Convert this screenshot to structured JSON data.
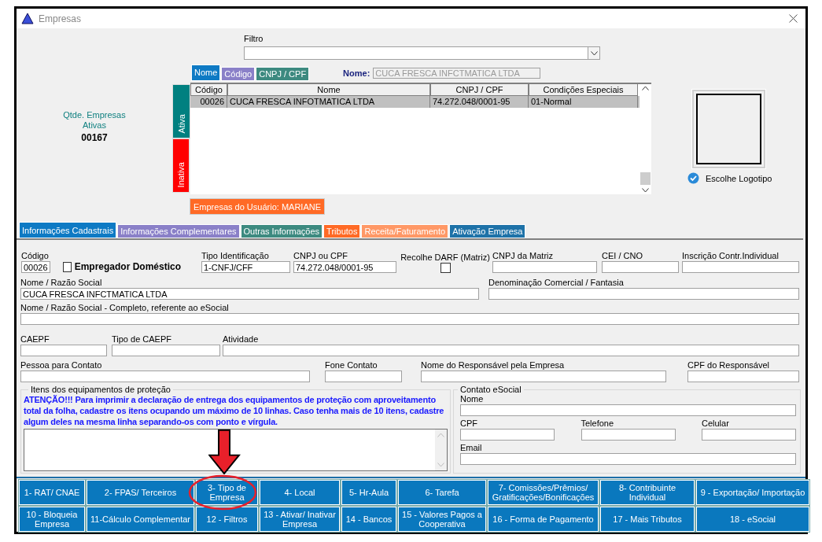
{
  "window": {
    "title": "Empresas"
  },
  "summary": {
    "label": "Qtde. Empresas",
    "sublabel": "Ativas",
    "count": "00167"
  },
  "filter": {
    "label": "Filtro"
  },
  "search": {
    "tabs": [
      {
        "label": "Nome",
        "selected": true,
        "color": "#0e7ac4"
      },
      {
        "label": "Código",
        "selected": false,
        "color": "#8a80c8"
      },
      {
        "label": "CNPJ / CPF",
        "selected": false,
        "color": "#3d8a80"
      }
    ],
    "name_label": "Nome:",
    "name_value": "CUCA FRESCA INFCTMATICA LTDA"
  },
  "status_tabs": [
    {
      "label": "Ativa",
      "selected": true,
      "color": "#008080"
    },
    {
      "label": "Inativa",
      "selected": false,
      "color": "#ff0000"
    }
  ],
  "table": {
    "columns": [
      "Código",
      "Nome",
      "CNPJ / CPF",
      "Condições Especiais"
    ],
    "rows": [
      {
        "cells": [
          "00026",
          "CUCA FRESCA INFOTMATICA LTDA",
          "74.272.048/0001-95",
          "01-Normal"
        ],
        "selected": true
      }
    ]
  },
  "user_button": "Empresas do Usuário: MARIANE",
  "logo": {
    "button": "Escolhe Logotipo"
  },
  "tabs": [
    {
      "label": "Informações Cadastrais",
      "selected": true,
      "color": "#0e7ac4"
    },
    {
      "label": "Informações Complementares",
      "selected": false,
      "color": "#8a80c8"
    },
    {
      "label": "Outras Informações",
      "selected": false,
      "color": "#3d8a80"
    },
    {
      "label": "Tributos",
      "selected": false,
      "color": "#ff6a26"
    },
    {
      "label": "Receita/Faturamento",
      "selected": false,
      "color": "#ff9866"
    },
    {
      "label": "Ativação Empresa",
      "selected": false,
      "color": "#1e72a8"
    }
  ],
  "form": {
    "fields": [
      {
        "kind": "text",
        "label": "Código",
        "value": "00026"
      },
      {
        "kind": "checkbox_inline",
        "label": "Empregador Doméstico",
        "checked": false
      },
      {
        "kind": "text",
        "label": "Tipo Identificação",
        "value": "1-CNFJ/CFF"
      },
      {
        "kind": "text",
        "label": "CNPJ ou CPF",
        "value": "74.272.048/0001-95"
      },
      {
        "kind": "checkbox_below",
        "label": "Recolhe DARF (Matriz)",
        "checked": false
      },
      {
        "kind": "text",
        "label": "CNPJ da Matriz"
      },
      {
        "kind": "text",
        "label": "CEI / CNO"
      },
      {
        "kind": "text",
        "label": "Inscrição Contr.Individual"
      },
      {
        "kind": "text",
        "label": "Nome / Razão Social",
        "value": "CUCA FRESCA INFCTMATICA LTDA"
      },
      {
        "kind": "text",
        "label": "Denominação Comercial / Fantasia"
      },
      {
        "kind": "text",
        "label": "Nome / Razão Social - Completo, referente ao eSocial"
      },
      {
        "kind": "text",
        "label": "CAEPF"
      },
      {
        "kind": "text",
        "label": "Tipo de CAEPF"
      },
      {
        "kind": "text",
        "label": "Atividade"
      },
      {
        "kind": "text",
        "label": "Pessoa para Contato"
      },
      {
        "kind": "text",
        "label": "Fone Contato"
      },
      {
        "kind": "text",
        "label": "Nome do Responsável pela Empresa"
      },
      {
        "kind": "text",
        "label": "CPF do Responsável"
      }
    ]
  },
  "equipment": {
    "legend": "Itens dos equipamentos de proteção",
    "warning": "ATENÇÃO!!! Para imprimir a declaração de entrega dos equipamentos de proteção com aproveitamento total da folha, cadastre os itens ocupando um máximo de 10 linhas. Caso tenha mais de 10 itens, cadastre algum deles na mesma linha separando-os com ponto e vírgula."
  },
  "esocial_contact": {
    "legend": "Contato eSocial",
    "rows": [
      [
        {
          "label": "Nome"
        }
      ],
      [
        {
          "label": "CPF"
        },
        {
          "label": "Telefone"
        },
        {
          "label": "Celular"
        }
      ],
      [
        {
          "label": "Email"
        }
      ]
    ]
  },
  "actions": [
    "1- RAT/ CNAE",
    "2- FPAS/ Terceiros",
    "3- Tipo de Empresa",
    "4- Local",
    "5- Hr-Aula",
    "6- Tarefa",
    "7- Comissões/Prêmios/ Gratificações/Bonificações",
    "8- Contribuinte Individual",
    "9 - Exportação/ Importação",
    "10 - Bloqueia Empresa",
    "11-Cálculo Complementar",
    "12 - Filtros",
    "13 - Ativar/ Inativar Empresa",
    "14 - Bancos",
    "15 - Valores Pagos a Cooperativa",
    "16 - Forma de Pagamento",
    "17 - Mais Tributos",
    "18 - eSocial"
  ]
}
